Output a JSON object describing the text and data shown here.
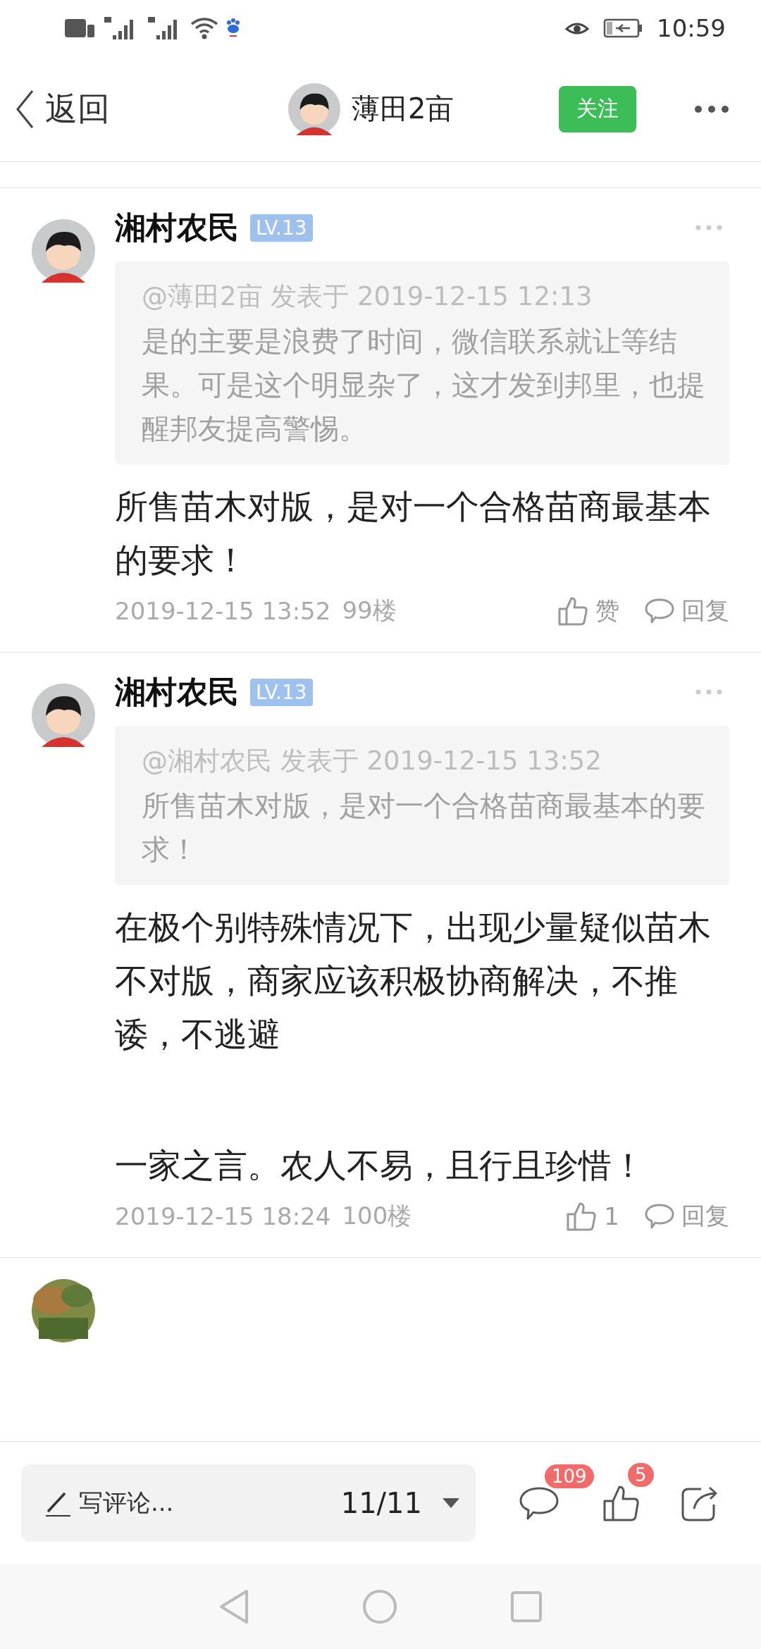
{
  "status_bar": {
    "time": "10:59"
  },
  "header": {
    "back_label": "返回",
    "user_name": "薄田2亩",
    "follow_label": "关注"
  },
  "comments": [
    {
      "author": "湘村农民",
      "level_badge": "LV.13",
      "quote": {
        "meta": "@薄田2亩 发表于 2019-12-15 12:13",
        "text": "是的主要是浪费了时间，微信联系就让等结果。可是这个明显杂了，这才发到邦里，也提醒邦友提高警惕。"
      },
      "paragraphs": [
        "所售苗木对版，是对一个合格苗商最基本的要求！"
      ],
      "date": "2019-12-15 13:52",
      "floor": "99楼",
      "like_label": "赞",
      "reply_label": "回复"
    },
    {
      "author": "湘村农民",
      "level_badge": "LV.13",
      "quote": {
        "meta": "@湘村农民 发表于 2019-12-15 13:52",
        "text": "所售苗木对版，是对一个合格苗商最基本的要求！"
      },
      "paragraphs": [
        "在极个别特殊情况下，出现少量疑似苗木不对版，商家应该积极协商解决，不推诿，不逃避",
        "一家之言。农人不易，且行且珍惜！"
      ],
      "date": "2019-12-15 18:24",
      "floor": "100楼",
      "like_label": "1",
      "reply_label": "回复"
    }
  ],
  "bottom_bar": {
    "comment_placeholder": "写评论...",
    "page": "11/11",
    "comment_count": "109",
    "like_count": "5"
  }
}
